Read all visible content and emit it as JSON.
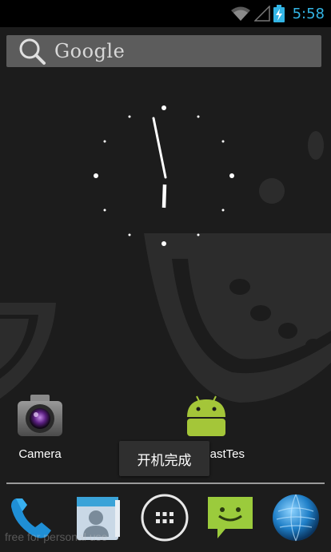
{
  "status_bar": {
    "time": "5:58",
    "icons": [
      "wifi-icon",
      "cell-signal-icon",
      "battery-charging-icon"
    ]
  },
  "search": {
    "label": "Google"
  },
  "home_apps": [
    {
      "label": "Camera",
      "icon": "camera-icon"
    },
    {
      "label": "astTes",
      "icon": "android-icon"
    }
  ],
  "toast": {
    "message": "开机完成"
  },
  "dock": {
    "items": [
      "phone-icon",
      "contacts-icon",
      "all-apps-icon",
      "messaging-icon",
      "browser-icon"
    ]
  },
  "watermark": {
    "text": "free for personal use"
  },
  "colors": {
    "accent": "#33b5e5",
    "android_green": "#a4c639",
    "wallpaper_shape": "#2c2c2c"
  }
}
